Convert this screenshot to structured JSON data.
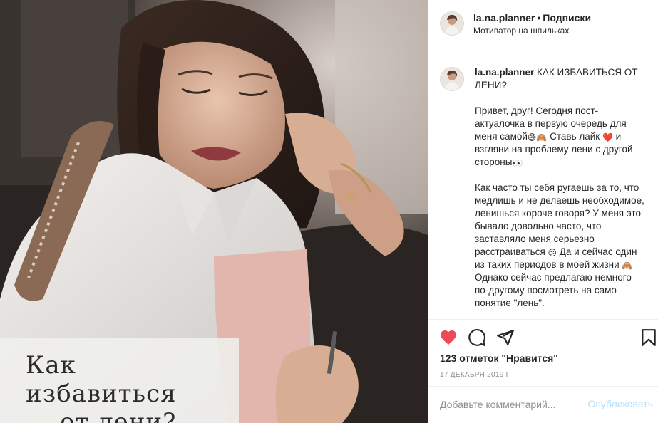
{
  "header": {
    "username": "la.na.planner",
    "separator": "•",
    "follow_label": "Подписки",
    "subtitle": "Мотиватор на шпильках"
  },
  "photo": {
    "overlay_line1": "Как избавиться",
    "overlay_line2": "от лени?"
  },
  "caption": {
    "username": "la.na.planner",
    "title": "КАК ИЗБАВИТЬСЯ ОТ ЛЕНИ?",
    "p1_a": "Привет, друг! Сегодня пост-актуалочка в первую очередь для меня самой",
    "p1_emoji1": "😅🙈",
    "p1_b": " Ставь лайк ",
    "p1_heart": "❤️",
    "p1_c": " и взгляни на проблему лени с другой стороны",
    "p1_emoji2": "👀",
    "p2_a": "Как часто ты себя ругаешь за то, что медлишь и не делаешь необходимое, ленишься короче говоря? У меня это бывало довольно часто, что заставляло меня серьезно расстраиваться ",
    "p2_emoji1": "😕",
    "p2_b": " Да и сейчас один из таких периодов в моей жизни ",
    "p2_emoji2": "🙈",
    "p2_c": " Однако сейчас предлагаю немного по-другому посмотреть на само понятие \"лень\"."
  },
  "actions": {
    "like_icon": "heart-filled-icon",
    "comment_icon": "comment-bubble-icon",
    "share_icon": "paper-plane-icon",
    "save_icon": "bookmark-icon",
    "likes_text": "123 отметок \"Нравится\"",
    "date_text": "17 ДЕКАБРЯ 2019 Г."
  },
  "comment_box": {
    "placeholder": "Добавьте комментарий...",
    "post_label": "Опубликовать"
  },
  "colors": {
    "like_red": "#ed4956",
    "post_button_disabled": "#b2dffc",
    "muted_text": "#8e8e8e",
    "border": "#efefef"
  }
}
